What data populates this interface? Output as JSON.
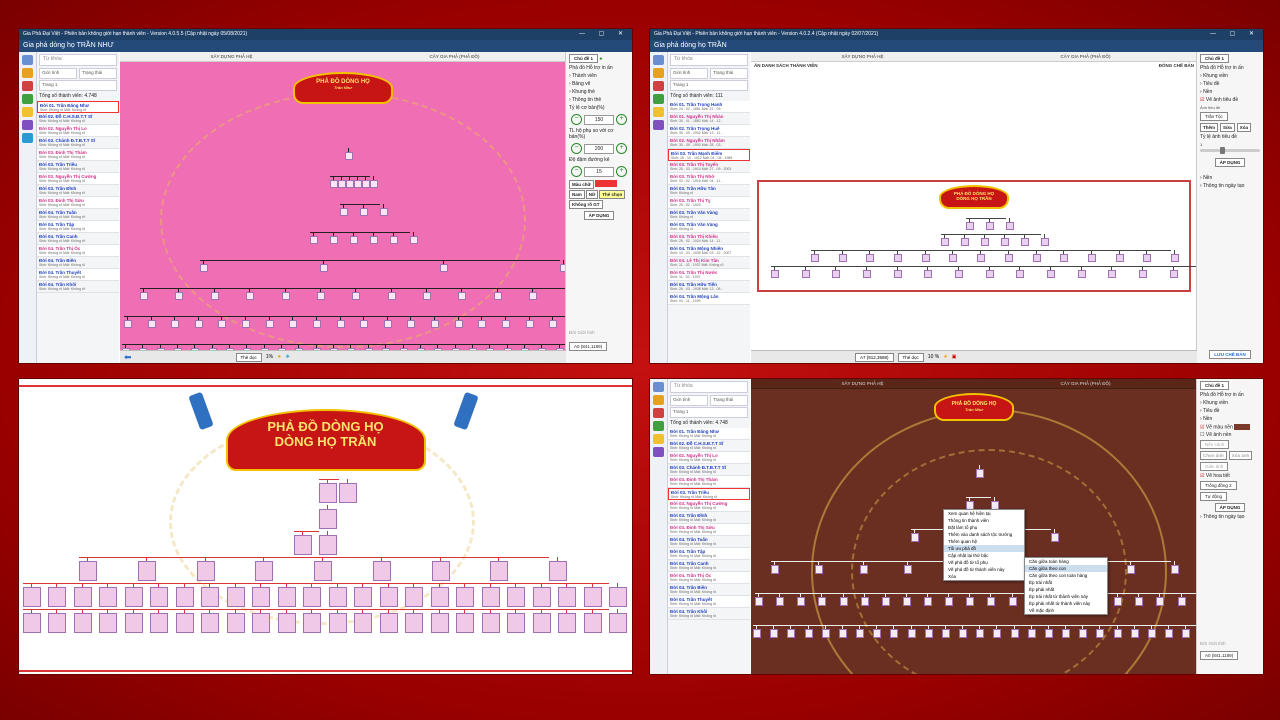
{
  "p1": {
    "window_title": "Gia Phả Đại Việt - Phiên bản không giới hạn thành viên - Version 4.0.5.5 (Cập nhật ngày 05/08/2021)",
    "app_title": "Gia phả dòng họ TRẦN NHƯ",
    "search_placeholder": "Từ khóa",
    "filter_gender": "Giới tính",
    "filter_status": "Trạng thái",
    "page": "Trang 1",
    "member_count_label": "Tổng số thành viên:",
    "member_count": "4.748",
    "tab_left": "XÂY DỰNG PHẢ HỆ",
    "tab_right": "CÂY GIA PHẢ (PHẢ ĐỒ)",
    "members": [
      {
        "name": "Đời 01. Trần Đăng Như",
        "info": "Sinh: Không rõ   Mất: Không rõ"
      },
      {
        "name": "Đời 02. Đỗ C.H.S.Đ.T.T Sĩ",
        "info": "Sinh: Không rõ   Mất: Không rõ"
      },
      {
        "name": "Đời 02. Nguyễn Thị Lo",
        "info": "Sinh: Không rõ   Mất: Không rõ"
      },
      {
        "name": "Đời 03. Chánh Đ.T.B.T.T Sĩ",
        "info": "Sinh: Không rõ   Mất: Không rõ"
      },
      {
        "name": "Đời 03. Đinh Thị Thàm",
        "info": "Sinh: Không rõ   Mất: Không rõ"
      },
      {
        "name": "Đời 03. Trần Triều",
        "info": "Sinh: Không rõ   Mất: Không rõ"
      },
      {
        "name": "Đời 03. Nguyễn Thị Cường",
        "info": "Sinh: Không rõ   Mất: Không rõ"
      },
      {
        "name": "Đời 03. Trần Đĩnh",
        "info": "Sinh: Không rõ   Mất: Không rõ"
      },
      {
        "name": "Đời 03. Đinh Thị Sửu",
        "info": "Sinh: Không rõ   Mất: Không rõ"
      },
      {
        "name": "Đời 04. Trần Tuấn",
        "info": "Sinh: Không rõ   Mất: Không rõ"
      },
      {
        "name": "Đời 04. Trần Tập",
        "info": "Sinh: Không rõ   Mất: Không rõ"
      },
      {
        "name": "Đời 04. Trần Canh",
        "info": "Sinh: Không rõ   Mất: Không rõ"
      },
      {
        "name": "Đời 04. Trần Thị Ốc",
        "info": "Sinh: Không rõ   Mất: Không rõ"
      },
      {
        "name": "Đời 04. Trần Biên",
        "info": "Sinh: Không rõ   Mất: Không rõ"
      },
      {
        "name": "Đời 04. Trần Thuyết",
        "info": "Sinh: Không rõ   Mất: Không rõ"
      },
      {
        "name": "Đời 04. Trần Khôi",
        "info": "Sinh: Không rõ   Mất: Không rõ"
      }
    ],
    "side": {
      "theme": "Chủ đề 1",
      "showlabel": "Phả đồ",
      "help": "Hỗ trợ in ấn",
      "opts": [
        "Thành viên",
        "Bảng vẽ",
        "Khung thẻ",
        "Thông tin thẻ"
      ],
      "ratio_label": "Tỷ lệ cơ bản(%)",
      "ratio": "150",
      "spouse_label": "TL hộ phụ so với cơ bản(%)",
      "spouse": "200",
      "line_label": "Độ đậm đường kẻ",
      "line": "15",
      "colors_label": "Màu chữ",
      "nam": "Nam",
      "nu": "Nữ",
      "the_chon": "Thẻ chọn",
      "khong_ro": "Không rõ GT",
      "apply": "ÁP DỤNG",
      "chk_doi": "Đời",
      "chk_gt": "Giới tính",
      "paper": "A0 (841,1189)"
    },
    "bottom": {
      "layout": "Thẻ dọc",
      "zoom": "1%"
    },
    "banner_title": "PHẢ ĐỒ DÒNG HỌ",
    "banner_sub": "Trần Như"
  },
  "p2": {
    "window_title": "Gia Phả Đại Việt - Phiên bản không giới hạn thành viên - Version 4.0.2.4 (Cập nhật ngày 02/07/2021)",
    "app_title": "Gia phả dòng họ TRẦN",
    "search_placeholder": "Từ khóa",
    "filter_gender": "Giới tính",
    "filter_status": "Trạng thái",
    "page": "Trang 1",
    "member_count_label": "Tổng số thành viên:",
    "member_count": "111",
    "tab_left": "XÂY DỰNG PHẢ HỆ",
    "tab_right": "CÂY GIA PHẢ (PHẢ ĐỒ)",
    "canvas_left": "ĂN DANH SÁCH THÀNH VIÊN",
    "canvas_right": "ĐÓNG CHẾ BẢN",
    "members": [
      {
        "name": "Đời 01. Trần Trọng Hanh",
        "info": "Sinh: 24 - 02 - 1881   Mất: 22 - 09 -"
      },
      {
        "name": "Đời 01. Nguyễn Thị Nhàn",
        "info": "Sinh: 30 - 01 - 1882   Mất: 14 - 12 -"
      },
      {
        "name": "Đời 02. Trần Trọng Huê",
        "info": "Sinh: 30 - 09 - 1902   Mất: 13 - 11 -"
      },
      {
        "name": "Đời 02. Nguyễn Thị Nhâm",
        "info": "Sinh: 30 - 09 - 1900   Mất: 28 - 03 -"
      },
      {
        "name": "Đời 03. Trần Mạnh Điểm",
        "info": "Sinh: 18 - 10 - 1912   Mất: 04 - 08 - 1985"
      },
      {
        "name": "Đời 03. Trần Thị Tuyến",
        "info": "Sinh: 25 - 03 - 1914   Mất: 27 - 09 - 2003"
      },
      {
        "name": "Đời 03. Trần Thị Nhớ",
        "info": "Sinh: 02 - 02 - 1916   Mất: 04 - 11 -"
      },
      {
        "name": "Đời 03. Trần Hữu Tân",
        "info": "Sinh: Không rõ"
      },
      {
        "name": "Đời 03. Trần Thị Tỵ",
        "info": "Sinh: 25 - 02 - 1920"
      },
      {
        "name": "Đời 03. Trần Văn Vàng",
        "info": "Sinh: Không rõ"
      },
      {
        "name": "Đời 03. Trần Văn Vàng",
        "info": "Sinh: Không rõ"
      },
      {
        "name": "Đời 03. Trần Thị Khiêu",
        "info": "Sinh: 25 - 02 - 1924   Mất: 14 - 11 -"
      },
      {
        "name": "Đời 04. Trần Mộng Nhiên",
        "info": "Sinh: 10 - 03 - 1935   Mất: 03 - 12 - 2007"
      },
      {
        "name": "Đời 04. Lê Thị Kim Tần",
        "info": "Sinh: 11 - 02 - 1937   Mất: Không rõ"
      },
      {
        "name": "Đời 04. Trần Thị Nước",
        "info": "Sinh: 11 - 02 - 1937"
      },
      {
        "name": "Đời 04. Trần Hữu Tiến",
        "info": "Sinh: 26 - 03 - 1938   Mất: 13 - 08 -"
      },
      {
        "name": "Đời 04. Trần Mộng Lân",
        "info": "Sinh: 04 - 11 - 1939"
      }
    ],
    "side": {
      "theme": "Chủ đề 1",
      "showlabel": "Phả đồ",
      "help": "Hỗ trợ in ấn",
      "opts": [
        "Khung viền",
        "Tiêu đề",
        "Nền"
      ],
      "chk_title": "Vẽ ảnh tiêu đề",
      "img_title_label": "Ảnh tiêu đề",
      "img_title": "Trần Tộc",
      "add": "Thêm",
      "edit": "Sửa",
      "del": "Xóa",
      "ratio_label": "Tỷ lệ ảnh tiêu đề",
      "ratio_val": "1",
      "apply": "ÁP DỤNG",
      "bg": "Nền",
      "date": "Thông tin ngày tạo",
      "save": "LƯU CHẾ BẢN"
    },
    "bottom": {
      "paper": "A7 (912,3598)",
      "layout": "Thẻ dọc",
      "zoom": "10 %"
    },
    "banner_title": "PHẢ ĐỒ DÒNG HỌ",
    "banner_sub": "DÒNG HỌ TRẦN"
  },
  "p3": {
    "banner_title": "PHẢ ĐỒ DÒNG HỌ",
    "banner_sub": "DÒNG HỌ TRẦN"
  },
  "p4": {
    "search_placeholder": "Từ khóa",
    "filter_gender": "Giới tính",
    "filter_status": "Trạng thái",
    "page": "Trang 1",
    "member_count_label": "Tổng số thành viên:",
    "member_count": "4.748",
    "tab_left": "XÂY DỰNG PHẢ HỆ",
    "tab_right": "CÂY GIA PHẢ (PHẢ ĐỒ)",
    "members": [
      {
        "name": "Đời 01. Trần Đăng Như",
        "info": "Sinh: Không rõ   Mất: Không rõ"
      },
      {
        "name": "Đời 02. Đỗ C.H.S.Đ.T.T Sĩ",
        "info": "Sinh: Không rõ   Mất: Không rõ"
      },
      {
        "name": "Đời 02. Nguyễn Thị Lo",
        "info": "Sinh: Không rõ   Mất: Không rõ"
      },
      {
        "name": "Đời 03. Chánh Đ.T.B.T.T Sĩ",
        "info": "Sinh: Không rõ   Mất: Không rõ"
      },
      {
        "name": "Đời 03. Đinh Thị Thàm",
        "info": "Sinh: Không rõ   Mất: Không rõ"
      },
      {
        "name": "Đời 03. Trần Triều",
        "info": "Sinh: Không rõ   Mất: Không rõ"
      },
      {
        "name": "Đời 03. Nguyễn Thị Cường",
        "info": "Sinh: Không rõ   Mất: Không rõ"
      },
      {
        "name": "Đời 03. Trần Đĩnh",
        "info": "Sinh: Không rõ   Mất: Không rõ"
      },
      {
        "name": "Đời 03. Đinh Thị Sửu",
        "info": "Sinh: Không rõ   Mất: Không rõ"
      },
      {
        "name": "Đời 04. Trần Tuấn",
        "info": "Sinh: Không rõ   Mất: Không rõ"
      },
      {
        "name": "Đời 04. Trần Tập",
        "info": "Sinh: Không rõ   Mất: Không rõ"
      },
      {
        "name": "Đời 04. Trần Canh",
        "info": "Sinh: Không rõ   Mất: Không rõ"
      },
      {
        "name": "Đời 04. Trần Thị Ốc",
        "info": "Sinh: Không rõ   Mất: Không rõ"
      },
      {
        "name": "Đời 04. Trần Biên",
        "info": "Sinh: Không rõ   Mất: Không rõ"
      },
      {
        "name": "Đời 04. Trần Thuyết",
        "info": "Sinh: Không rõ   Mất: Không rõ"
      },
      {
        "name": "Đời 04. Trần Khôi",
        "info": "Sinh: Không rõ   Mất: Không rõ"
      }
    ],
    "side": {
      "theme": "Chủ đề 1",
      "showlabel": "Phả đồ",
      "help": "Hỗ trợ in ấn",
      "opts": [
        "Khung viền",
        "Tiêu đề",
        "Nền"
      ],
      "chk_color": "Vẽ màu nền",
      "chk_img": "Vẽ ảnh nền",
      "bg_img": "Nền cánh",
      "choose": "Chọn ảnh",
      "del": "Xóa ảnh",
      "pattern": "Giản ảnh",
      "chk_text": "Vẽ hoa tiết",
      "pattern_sel": "Trống đồng 2",
      "auto": "Tự động",
      "apply": "ÁP DỤNG",
      "date": "Thông tin ngày tạo",
      "chk_doi": "Đời",
      "chk_gt": "Giới tính",
      "paper": "A0 (841,1189)"
    },
    "menu": [
      "Xem quan hệ hiện tại",
      "Thông tin thành viên",
      "Đặt làm tổ phụ",
      "Thêm vào danh sách tộc trưởng",
      "Thêm quan hệ",
      "Tối ưu phả đồ",
      "Cập nhật lại thứ bậc",
      "Vẽ phả đồ từ tổ phụ",
      "Vẽ phả đồ từ thành viên này",
      "Xóa"
    ],
    "submenu": [
      "Căn giữa toàn hàng",
      "Căn giữa theo con",
      "Căn giữa theo con toàn hàng",
      "Ép trái nhất",
      "Ép phải nhất",
      "Ép trái nhất từ thành viên này",
      "Ép phải nhất từ thành viên này",
      "Về mặc định"
    ],
    "banner_title": "PHẢ ĐỒ DÒNG HỌ",
    "banner_sub": "Trần Như"
  }
}
